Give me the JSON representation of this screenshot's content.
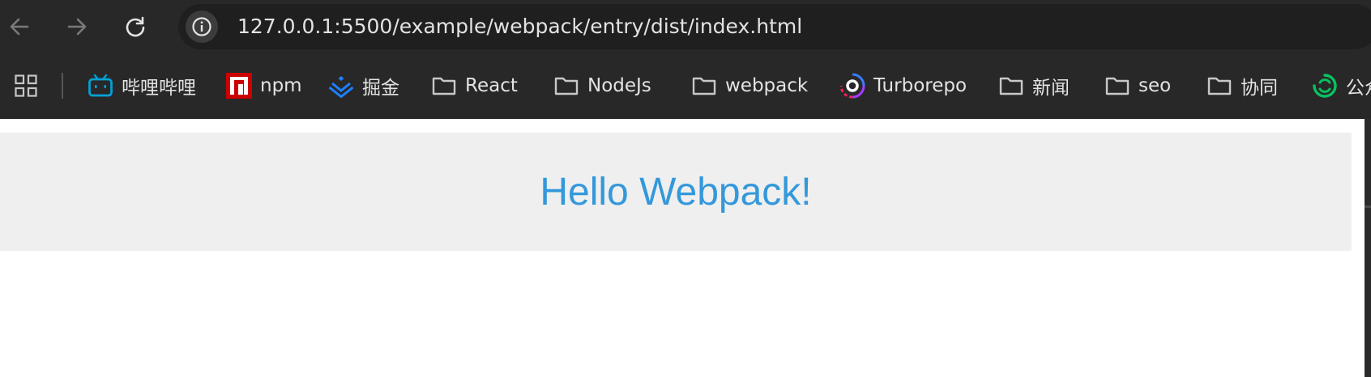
{
  "browser": {
    "url": "127.0.0.1:5500/example/webpack/entry/dist/index.html",
    "bookmarks": [
      {
        "label": "哔哩哔哩",
        "icon": "bilibili-icon"
      },
      {
        "label": "npm",
        "icon": "npm-icon"
      },
      {
        "label": "掘金",
        "icon": "juejin-icon"
      },
      {
        "label": "React",
        "icon": "folder-icon"
      },
      {
        "label": "NodeJs",
        "icon": "folder-icon"
      },
      {
        "label": "webpack",
        "icon": "folder-icon"
      },
      {
        "label": "Turborepo",
        "icon": "turborepo-icon"
      },
      {
        "label": "新闻",
        "icon": "folder-icon"
      },
      {
        "label": "seo",
        "icon": "folder-icon"
      },
      {
        "label": "协同",
        "icon": "folder-icon"
      },
      {
        "label": "公众",
        "icon": "wechat-icon"
      }
    ]
  },
  "page": {
    "heading": "Hello Webpack!"
  },
  "colors": {
    "chrome_bg": "#282828",
    "omnibox_bg": "#1f1f1f",
    "heading": "#3498db",
    "banner_bg": "#efefef"
  }
}
